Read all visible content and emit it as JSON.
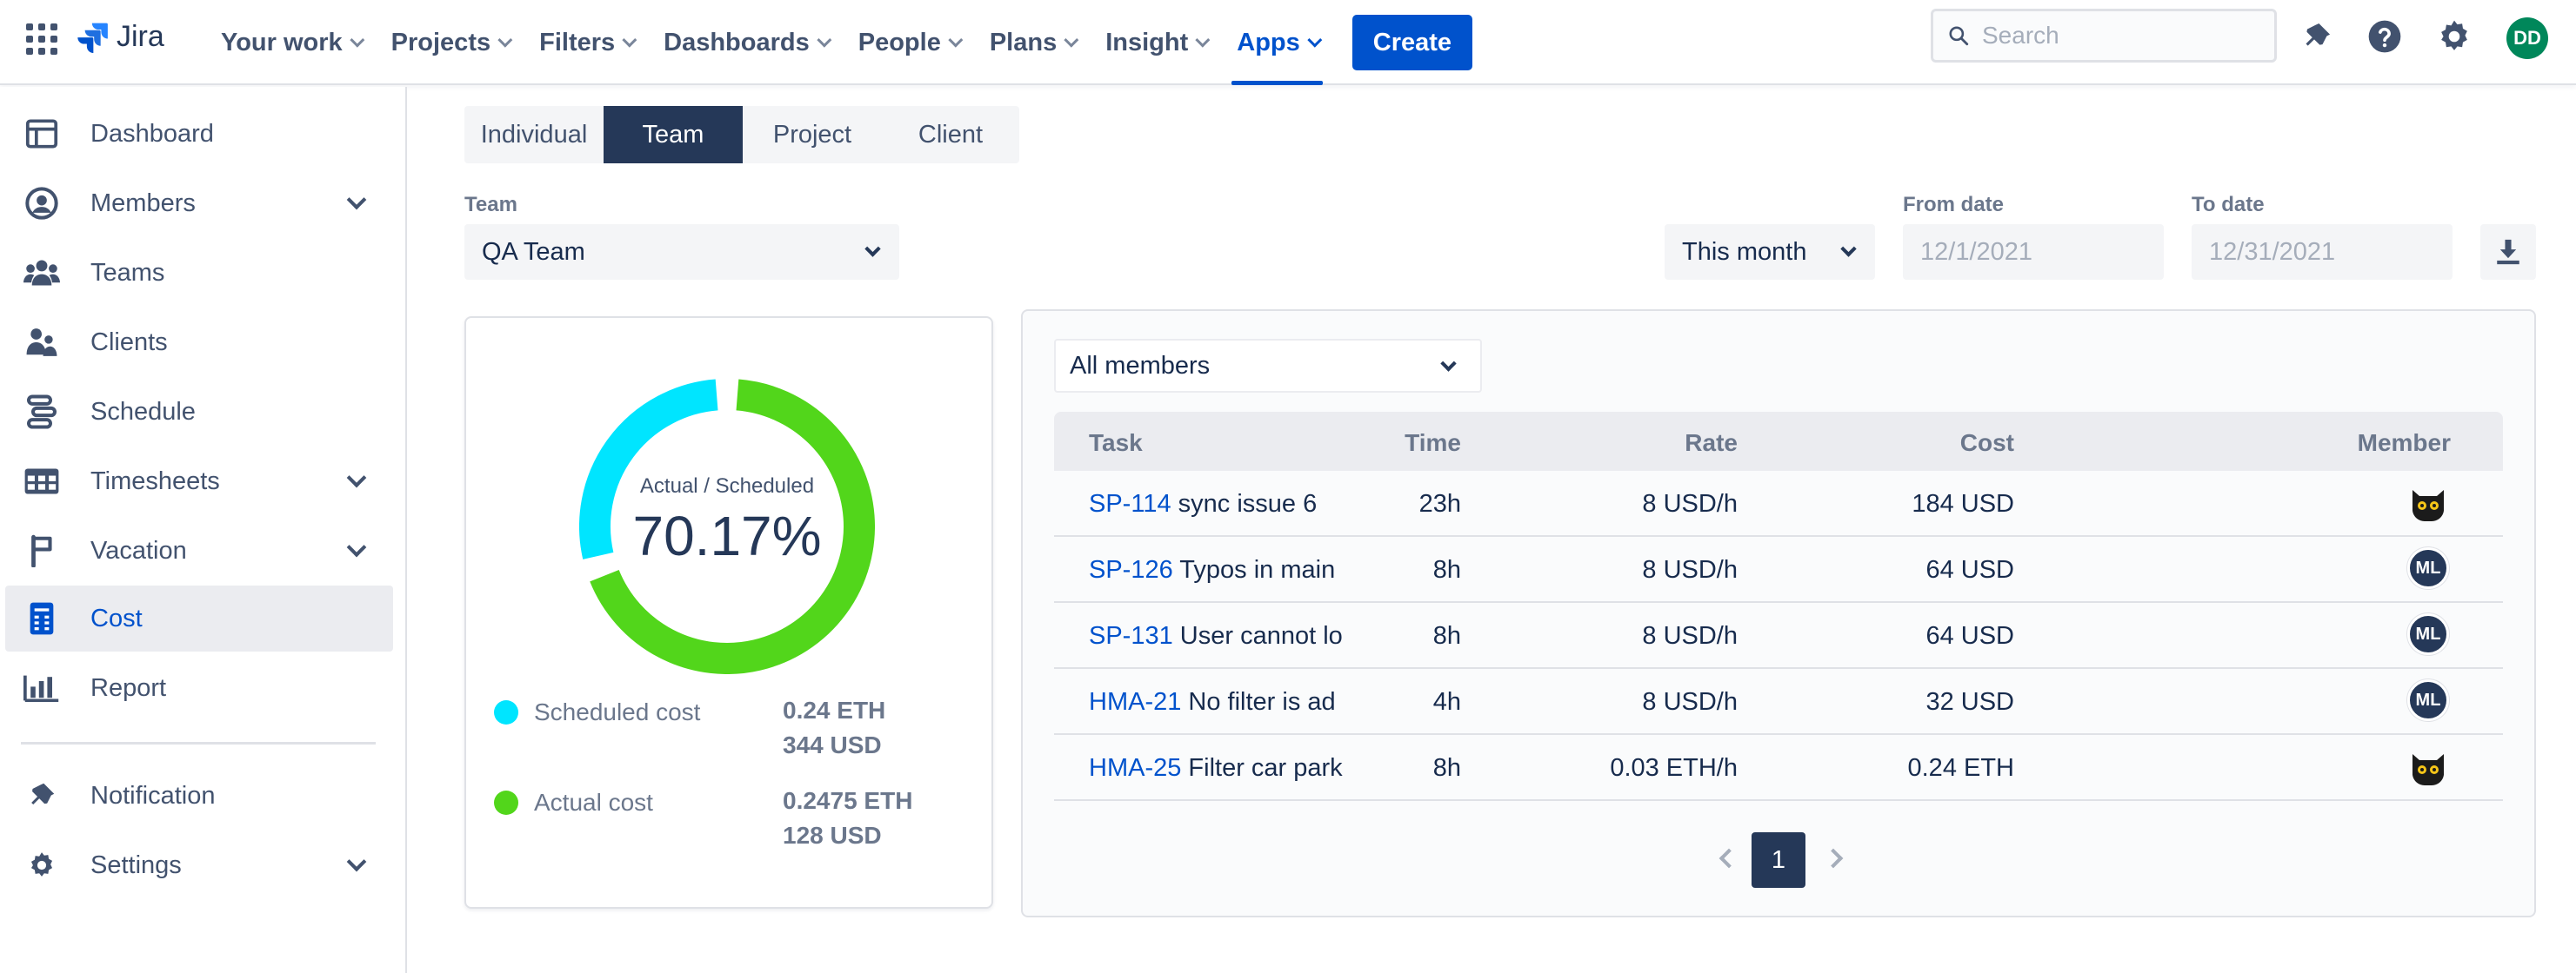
{
  "app": {
    "logo_text": "Jira",
    "brand_color": "#0052cc"
  },
  "topnav": {
    "items": [
      {
        "label": "Your work"
      },
      {
        "label": "Projects"
      },
      {
        "label": "Filters"
      },
      {
        "label": "Dashboards"
      },
      {
        "label": "People"
      },
      {
        "label": "Plans"
      },
      {
        "label": "Insight"
      },
      {
        "label": "Apps"
      }
    ],
    "active_item": "Apps",
    "create_label": "Create",
    "search_placeholder": "Search",
    "icons": [
      "notification-icon",
      "help-icon",
      "settings-icon"
    ],
    "user_initials": "DD"
  },
  "sidebar": {
    "items": [
      {
        "label": "Dashboard",
        "icon": "dashboard-icon"
      },
      {
        "label": "Members",
        "icon": "members-icon"
      },
      {
        "label": "Teams",
        "icon": "teams-icon"
      },
      {
        "label": "Clients",
        "icon": "clients-icon"
      },
      {
        "label": "Schedule",
        "icon": "schedule-icon"
      },
      {
        "label": "Timesheets",
        "icon": "timesheets-icon"
      },
      {
        "label": "Vacation",
        "icon": "vacation-icon"
      },
      {
        "label": "Cost",
        "icon": "cost-icon"
      },
      {
        "label": "Report",
        "icon": "report-icon"
      },
      {
        "label": "Notification",
        "icon": "notification-icon"
      },
      {
        "label": "Settings",
        "icon": "settings-icon"
      }
    ],
    "active_item": "Cost"
  },
  "tabs": {
    "items": [
      "Individual",
      "Team",
      "Project",
      "Client"
    ],
    "active": "Team"
  },
  "filters": {
    "team_label": "Team",
    "team_value": "QA Team",
    "period_value": "This month",
    "from_label": "From date",
    "from_value": "12/1/2021",
    "to_label": "To date",
    "to_value": "12/31/2021"
  },
  "summary": {
    "center_label": "Actual / Scheduled",
    "center_value": "70.17%",
    "ratio": 0.7017,
    "colors": {
      "scheduled": "#00e5ff",
      "actual": "#52d61b"
    },
    "scheduled_label": "Scheduled cost",
    "scheduled_eth": "0.24 ETH",
    "scheduled_usd": "344 USD",
    "actual_label": "Actual cost",
    "actual_eth": "0.2475 ETH",
    "actual_usd": "128 USD"
  },
  "table": {
    "member_filter": "All members",
    "columns": {
      "task": "Task",
      "time": "Time",
      "rate": "Rate",
      "cost": "Cost",
      "member": "Member"
    },
    "rows": [
      {
        "key": "SP-114",
        "title": "sync issue 6",
        "time": "23h",
        "rate": "8 USD/h",
        "cost": "184 USD",
        "member_avatar": "cat-avatar"
      },
      {
        "key": "SP-126",
        "title": "Typos in main",
        "time": "8h",
        "rate": "8 USD/h",
        "cost": "64 USD",
        "member_initials": "ML"
      },
      {
        "key": "SP-131",
        "title": "User cannot lo",
        "time": "8h",
        "rate": "8 USD/h",
        "cost": "64 USD",
        "member_initials": "ML"
      },
      {
        "key": "HMA-21",
        "title": "No filter is ad",
        "time": "4h",
        "rate": "8 USD/h",
        "cost": "32 USD",
        "member_initials": "ML"
      },
      {
        "key": "HMA-25",
        "title": "Filter car park",
        "time": "8h",
        "rate": "0.03 ETH/h",
        "cost": "0.24 ETH",
        "member_avatar": "cat-avatar"
      }
    ],
    "page": "1"
  }
}
